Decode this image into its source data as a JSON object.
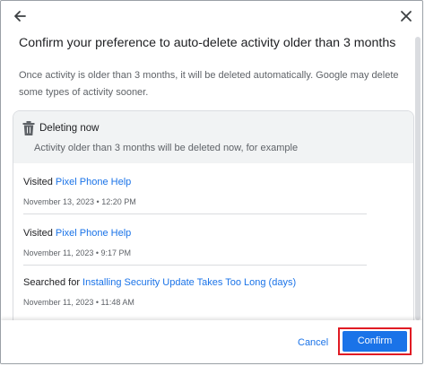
{
  "dialog": {
    "title": "Confirm your preference to auto-delete activity older than 3 months",
    "description": "Once activity is older than 3 months, it will be deleted automatically. Google may delete some types of activity sooner."
  },
  "deleting_now": {
    "heading": "Deleting now",
    "subtext": "Activity older than 3 months will be deleted now, for example",
    "icon": "trash-icon"
  },
  "activity_items": [
    {
      "prefix": "Visited ",
      "link": "Pixel Phone Help",
      "timestamp": "November 13, 2023 • 12:20 PM"
    },
    {
      "prefix": "Visited ",
      "link": "Pixel Phone Help",
      "timestamp": "November 11, 2023 • 9:17 PM"
    },
    {
      "prefix": "Searched for ",
      "link": "Installing Security Update Takes Too Long (days)",
      "timestamp": "November 11, 2023 • 11:48 AM"
    }
  ],
  "footer": {
    "cancel_label": "Cancel",
    "confirm_label": "Confirm"
  },
  "colors": {
    "accent": "#1a73e8",
    "highlight": "#e01b24",
    "card_header_bg": "#f1f3f4"
  }
}
